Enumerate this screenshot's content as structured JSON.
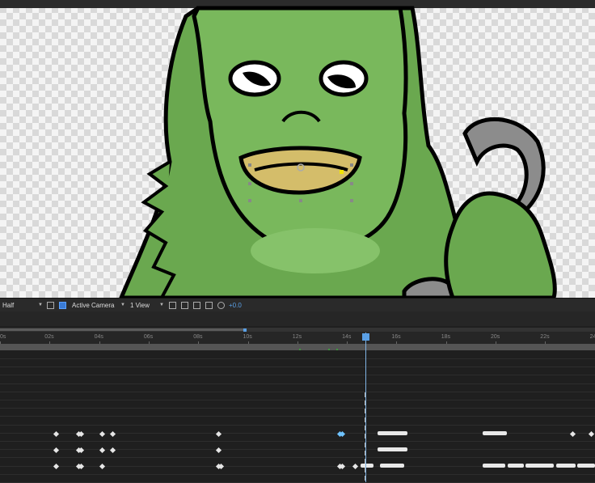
{
  "viewer": {
    "resolution": "Half",
    "camera": "Active Camera",
    "views": "1 View",
    "exposure": "+0.0"
  },
  "timeline": {
    "ruler_labels": [
      "0s",
      "02s",
      "04s",
      "06s",
      "08s",
      "10s",
      "12s",
      "14s",
      "16s",
      "18s",
      "20s",
      "22s",
      "24"
    ]
  },
  "colors": {
    "accent": "#5aa0e6",
    "monster_green": "#6aa84f",
    "lips": "#d4bd6a"
  }
}
